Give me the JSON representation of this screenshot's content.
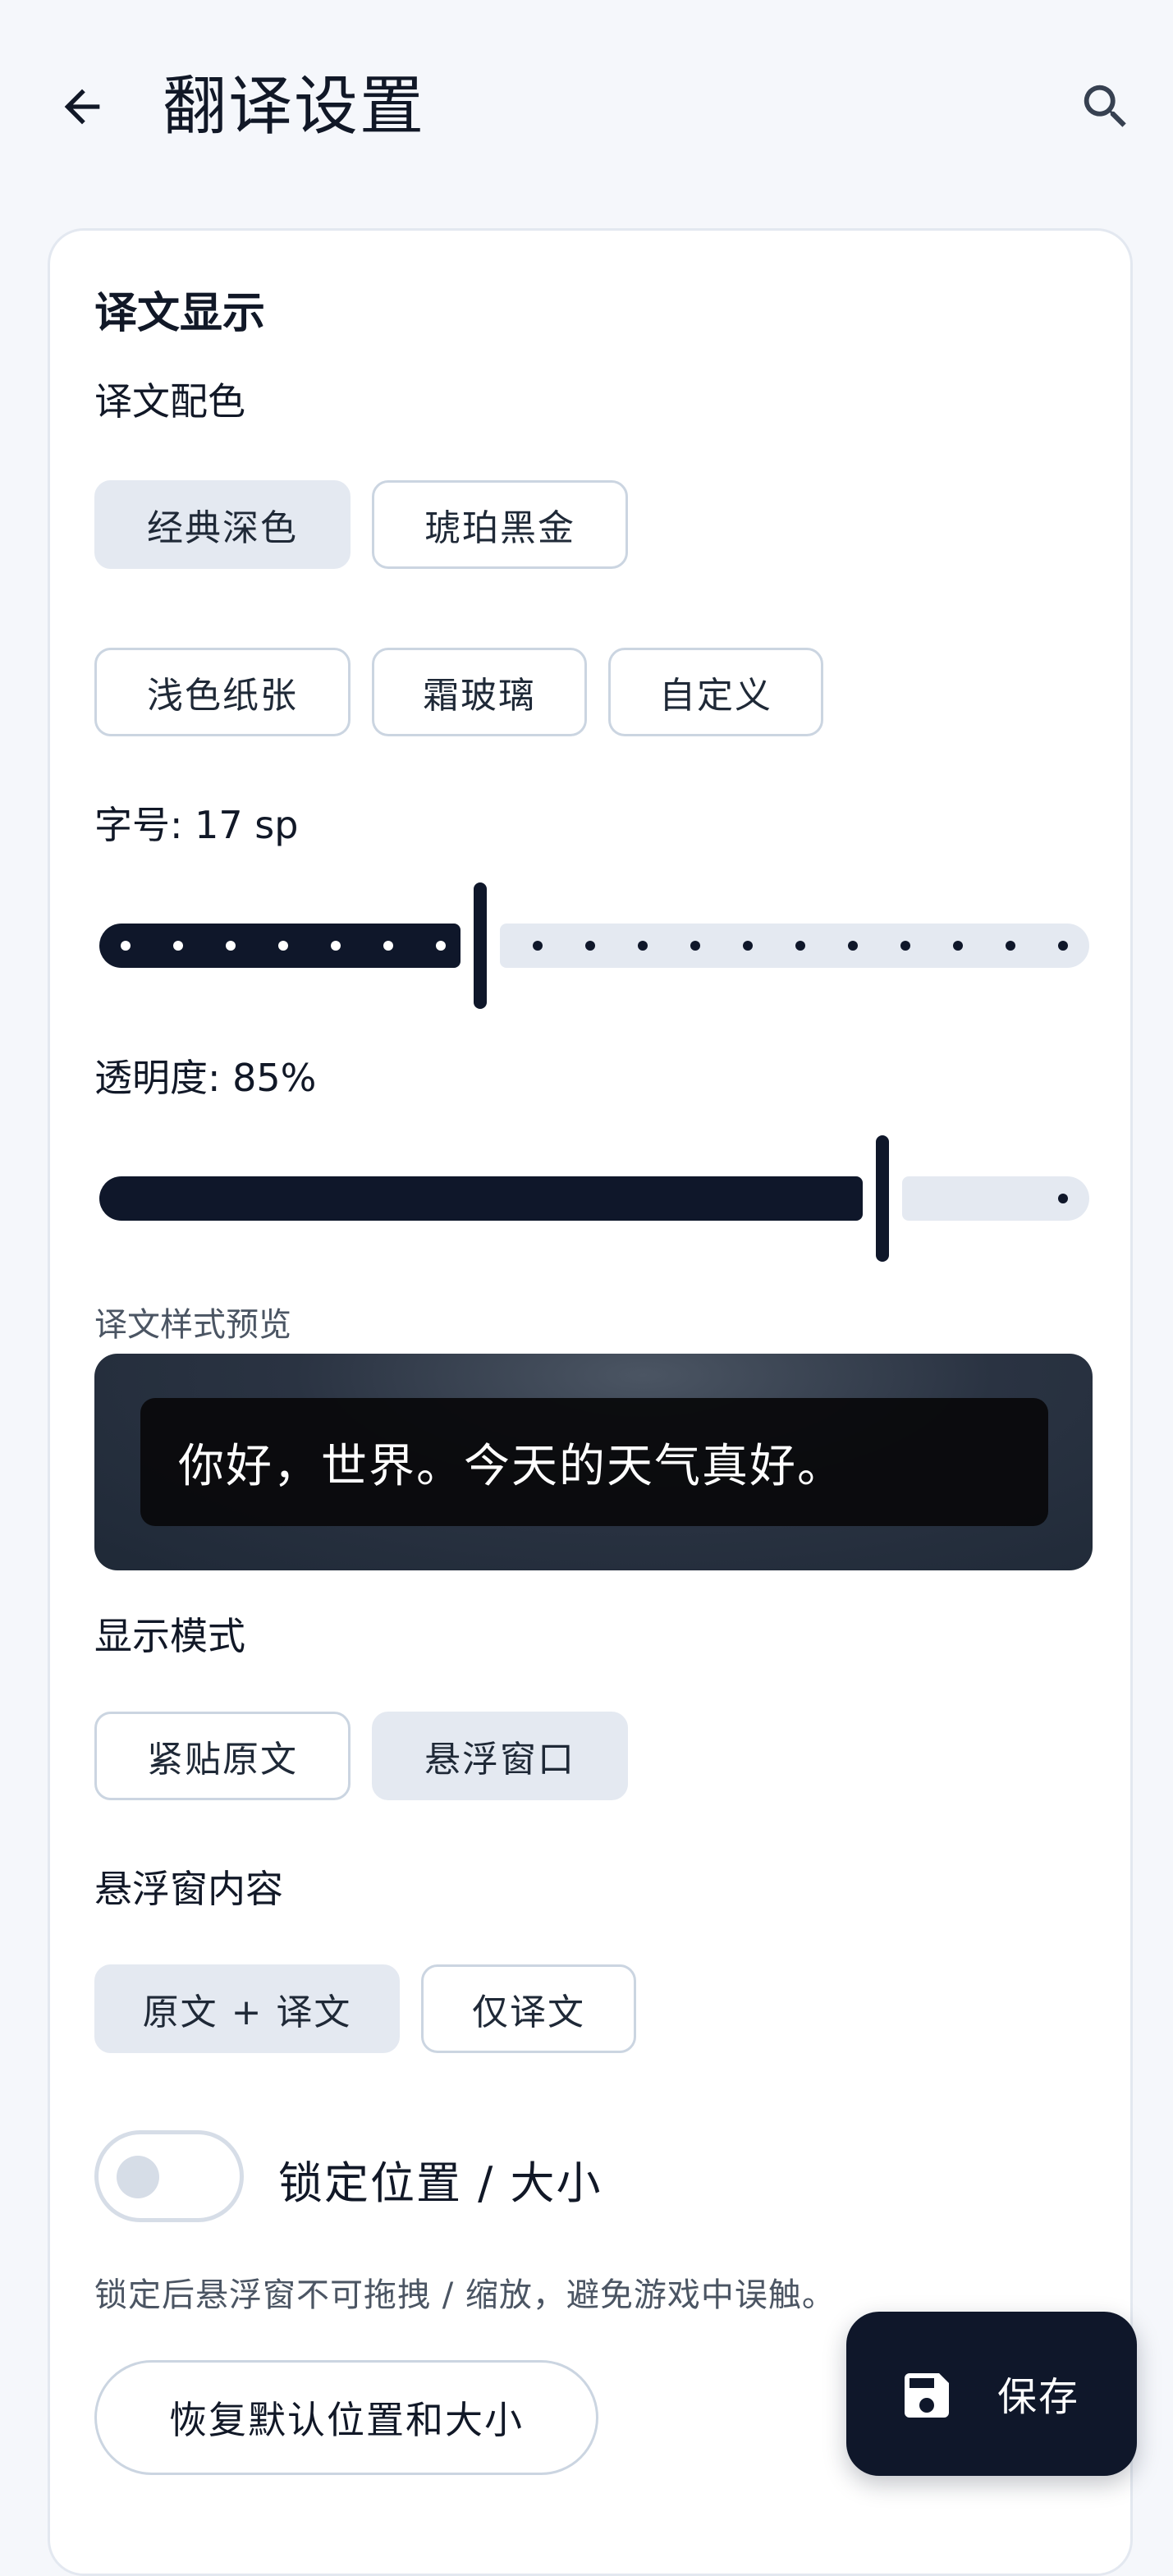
{
  "header": {
    "title": "翻译设置",
    "back_icon": "arrow-left-icon",
    "search_icon": "search-icon"
  },
  "section": {
    "title": "译文显示"
  },
  "color_scheme": {
    "label": "译文配色",
    "options": [
      {
        "label": "经典深色",
        "selected": true
      },
      {
        "label": "琥珀黑金",
        "selected": false
      },
      {
        "label": "浅色纸张",
        "selected": false
      },
      {
        "label": "霜玻璃",
        "selected": false
      },
      {
        "label": "自定义",
        "selected": false
      }
    ]
  },
  "font_size": {
    "label": "字号: 17 sp",
    "value_fraction": 0.38
  },
  "opacity": {
    "label": "透明度: 85%",
    "value_fraction": 0.85
  },
  "preview": {
    "label": "译文样式预览",
    "text": "你好，世界。今天的天气真好。"
  },
  "display_mode": {
    "label": "显示模式",
    "options": [
      {
        "label": "紧贴原文",
        "selected": false
      },
      {
        "label": "悬浮窗口",
        "selected": true
      }
    ]
  },
  "float_content": {
    "label": "悬浮窗内容",
    "options": [
      {
        "label": "原文 + 译文",
        "selected": true
      },
      {
        "label": "仅译文",
        "selected": false
      }
    ]
  },
  "lock": {
    "label": "锁定位置 / 大小",
    "enabled": false,
    "hint": "锁定后悬浮窗不可拖拽 / 缩放，避免游戏中误触。"
  },
  "reset_button": {
    "label": "恢复默认位置和大小"
  },
  "fab": {
    "label": "保存",
    "icon": "save-icon"
  },
  "colors": {
    "primary": "#0f172a",
    "chip_selected": "#e4e9f1",
    "outline": "#cbd5e1",
    "background": "#f5f7fb"
  }
}
